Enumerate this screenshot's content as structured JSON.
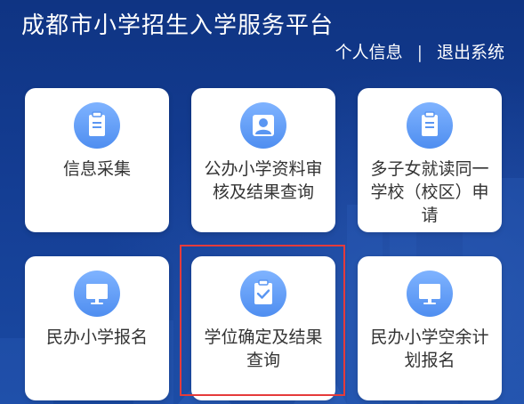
{
  "header": {
    "title": "成都市小学招生入学服务平台",
    "personal_info": "个人信息",
    "separator": "|",
    "logout": "退出系统"
  },
  "cards": [
    {
      "label": "信息采集",
      "icon": "clipboard-icon"
    },
    {
      "label": "公办小学资料审核及结果查询",
      "icon": "user-icon"
    },
    {
      "label": "多子女就读同一学校（校区）申请",
      "icon": "clipboard-icon"
    },
    {
      "label": "民办小学报名",
      "icon": "monitor-icon"
    },
    {
      "label": "学位确定及结果查询",
      "icon": "clipboard-check-icon"
    },
    {
      "label": "民办小学空余计划报名",
      "icon": "monitor-icon"
    }
  ],
  "colors": {
    "background": "#123a8c",
    "card": "#ffffff",
    "icon_gradient_top": "#7fb3ff",
    "icon_gradient_bottom": "#4f8ef0",
    "highlight": "#e53b3b",
    "label_text": "#333333"
  }
}
